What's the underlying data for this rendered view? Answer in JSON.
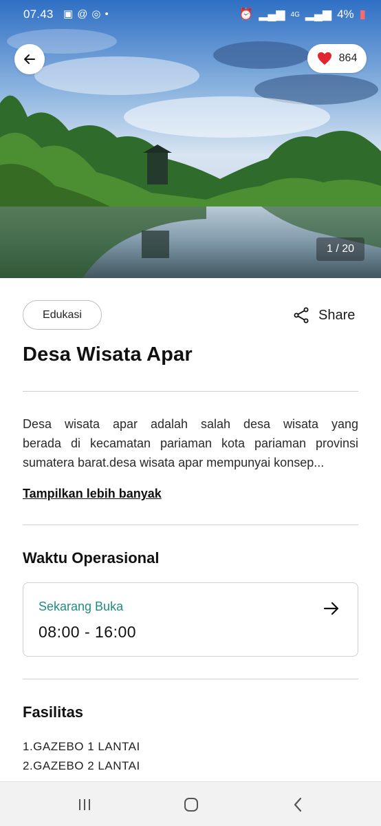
{
  "status_bar": {
    "time": "07.43",
    "battery": "4%",
    "network": "4G"
  },
  "hero": {
    "like_count": "864",
    "photo_counter": "1 / 20"
  },
  "place": {
    "category": "Edukasi",
    "share_label": "Share",
    "title": "Desa Wisata Apar",
    "description_lines": [
      "Desa wisata apar adalah salah desa wisata yang",
      "berada di kecamatan pariaman kota pariaman provinsi",
      "sumatera barat.desa wisata apar mempunyai konsep..."
    ],
    "more_link": "Tampilkan lebih banyak"
  },
  "hours": {
    "section_title": "Waktu Operasional",
    "status": "Sekarang Buka",
    "time_range": "08:00 - 16:00"
  },
  "facilities": {
    "section_title": "Fasilitas",
    "items": [
      "1.GAZEBO 1 LANTAI",
      "2.GAZEBO 2 LANTAI"
    ]
  },
  "colors": {
    "accent_green": "#1f8c7f",
    "heart_red": "#e0262f"
  },
  "icons": {
    "back": "arrow-left-icon",
    "like": "heart-icon",
    "share": "share-icon",
    "hours_arrow": "arrow-right-icon",
    "nav_recent": "recent-apps-icon",
    "nav_home": "home-icon",
    "nav_back": "nav-back-icon"
  }
}
